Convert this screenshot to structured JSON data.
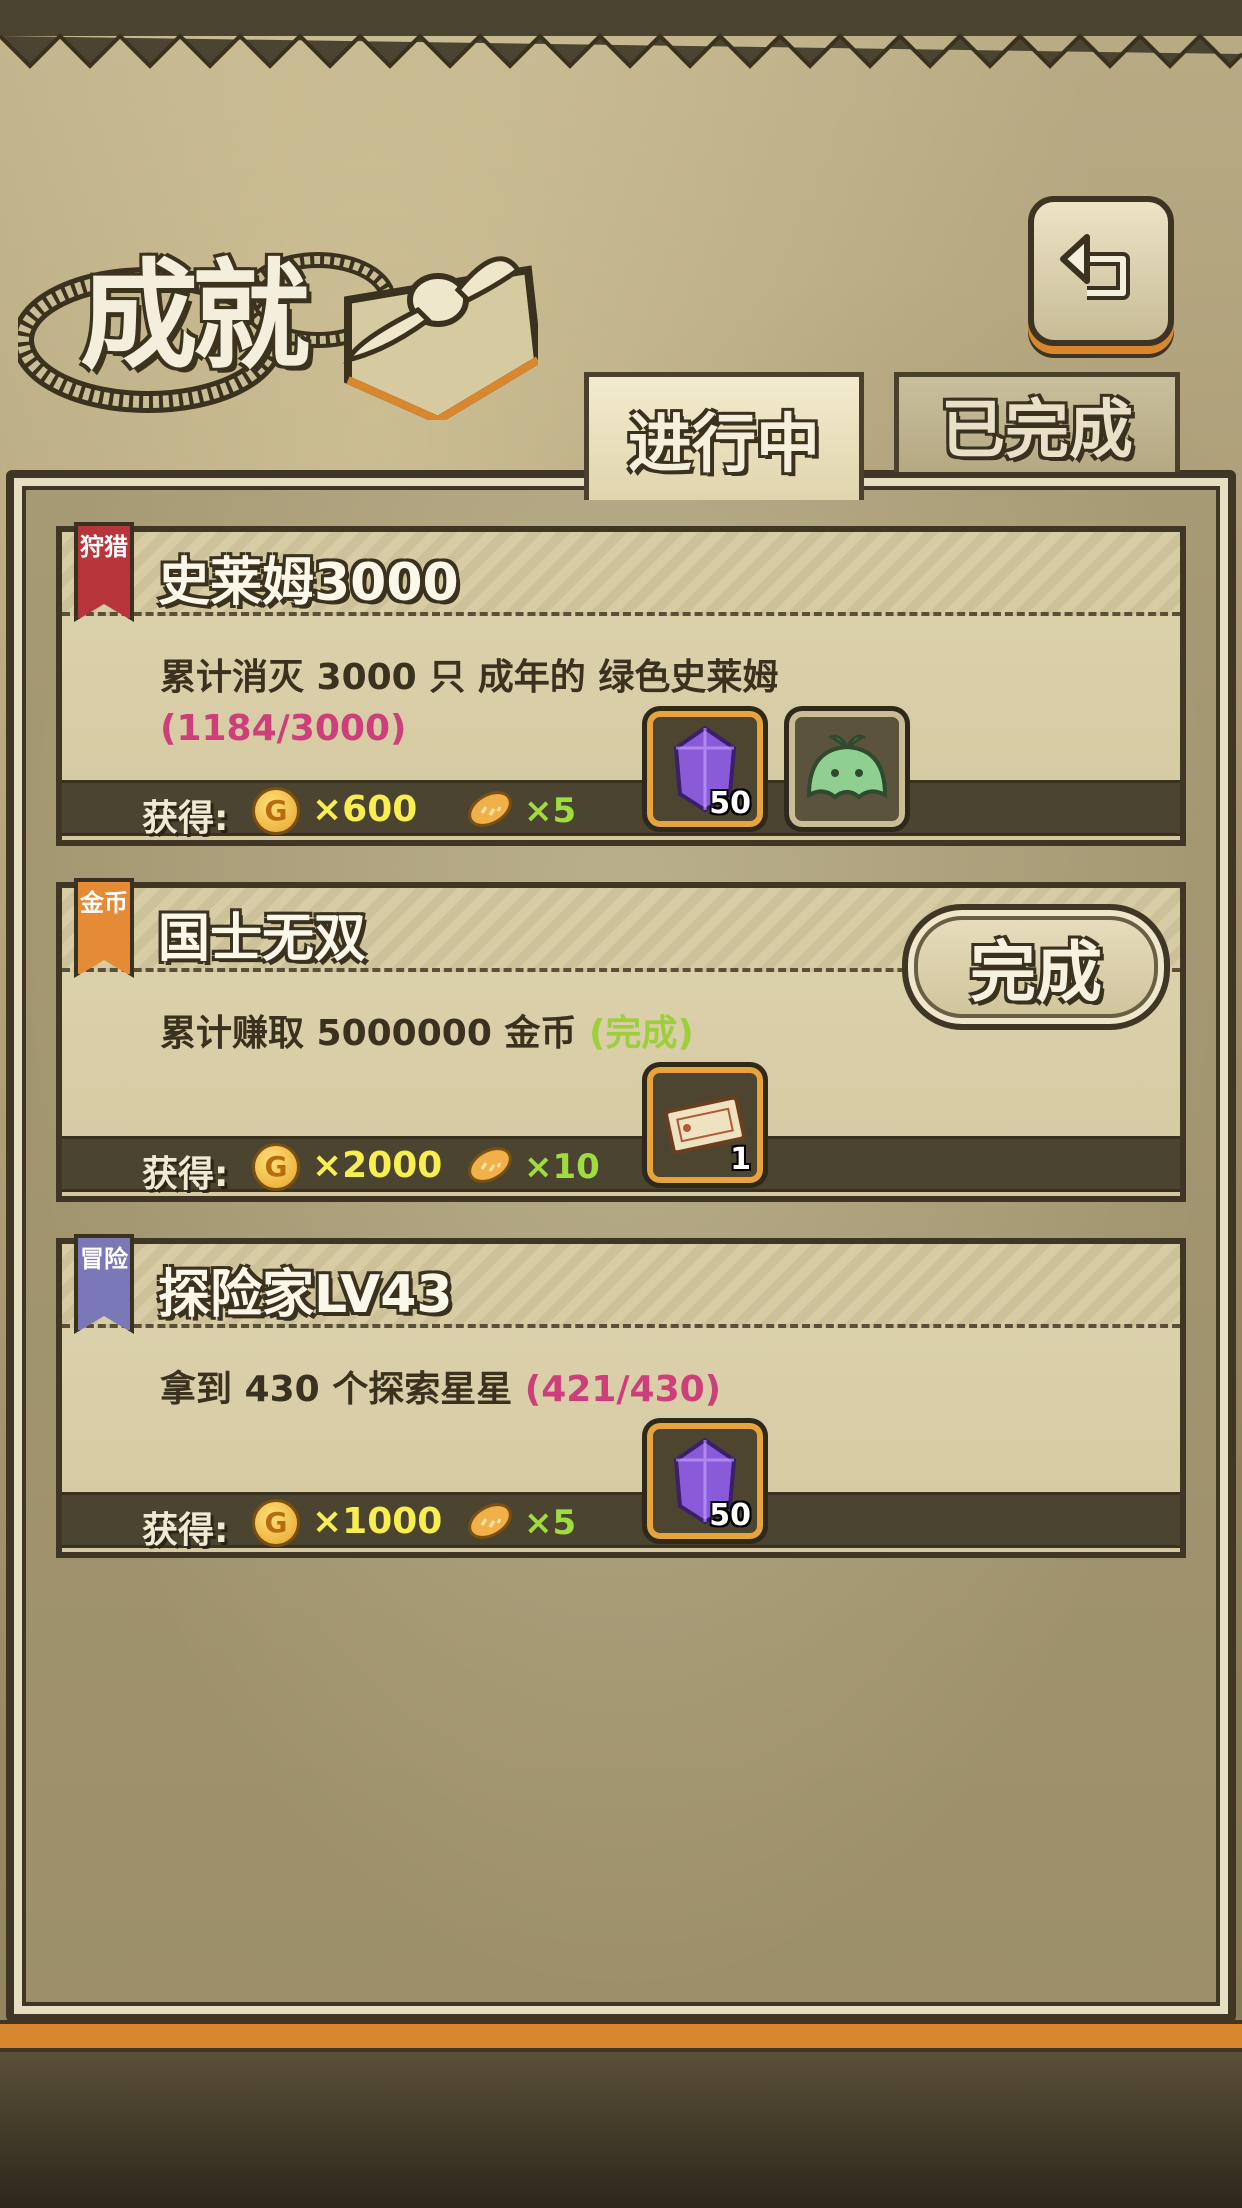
{
  "header": {
    "title": "成就",
    "back_icon": "return-arrow-icon"
  },
  "tabs": [
    {
      "label": "进行中",
      "active": true
    },
    {
      "label": "已完成",
      "active": false
    }
  ],
  "reward_label": "获得:",
  "achievements": [
    {
      "category": "狩猎",
      "category_color": "#b7353b",
      "title": "史莱姆3000",
      "description": "累计消灭 3000 只 成年的 绿色史莱姆",
      "progress": "(1184/3000)",
      "progress_color": "#cc3f7a",
      "gold": "×600",
      "bread": "×5",
      "items": [
        {
          "icon": "purple-crystal-icon",
          "count": "50"
        },
        {
          "icon": "green-slime-icon",
          "count": ""
        }
      ]
    },
    {
      "category": "金币",
      "category_color": "#e58a35",
      "title": "国士无双",
      "description": "累计赚取 5000000 金币",
      "progress": "(完成)",
      "progress_color": "#9dcf3d",
      "gold": "×2000",
      "bread": "×10",
      "complete_button": "完成",
      "items": [
        {
          "icon": "ticket-icon",
          "count": "1"
        }
      ]
    },
    {
      "category": "冒险",
      "category_color": "#7a78b6",
      "title": "探险家LV43",
      "description": "拿到 430 个探索星星",
      "progress": "(421/430)",
      "progress_color": "#cc3f7a",
      "gold": "×1000",
      "bread": "×5",
      "items": [
        {
          "icon": "purple-crystal-icon",
          "count": "50"
        }
      ]
    }
  ]
}
